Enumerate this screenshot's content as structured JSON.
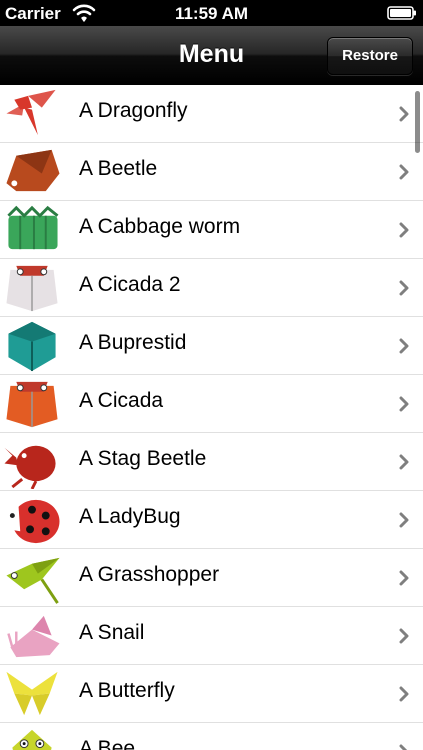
{
  "status_bar": {
    "carrier": "Carrier",
    "time": "11:59 AM"
  },
  "nav": {
    "title": "Menu",
    "restore_label": "Restore"
  },
  "items": [
    {
      "label": "A Dragonfly",
      "icon": "dragonfly-origami-icon",
      "color": "#d8372b"
    },
    {
      "label": "A Beetle",
      "icon": "beetle-origami-icon",
      "color": "#b84a1e"
    },
    {
      "label": "A Cabbage worm",
      "icon": "cabbage-worm-origami-icon",
      "color": "#3aa65a"
    },
    {
      "label": "A Cicada 2",
      "icon": "cicada-origami-icon",
      "color": "#e6e1e4"
    },
    {
      "label": "A Buprestid",
      "icon": "buprestid-origami-icon",
      "color": "#1f9c95"
    },
    {
      "label": "A Cicada",
      "icon": "cicada-origami-icon",
      "color": "#e35c23"
    },
    {
      "label": "A Stag Beetle",
      "icon": "stag-beetle-origami-icon",
      "color": "#b8261c"
    },
    {
      "label": "A LadyBug",
      "icon": "ladybug-origami-icon",
      "color": "#d8302c"
    },
    {
      "label": "A Grasshopper",
      "icon": "grasshopper-origami-icon",
      "color": "#9ec61e"
    },
    {
      "label": "A Snail",
      "icon": "snail-origami-icon",
      "color": "#e9a3c2"
    },
    {
      "label": "A Butterfly",
      "icon": "butterfly-origami-icon",
      "color": "#ece13c"
    },
    {
      "label": "A Bee",
      "icon": "bee-origami-icon",
      "color": "#c7d52b"
    }
  ]
}
